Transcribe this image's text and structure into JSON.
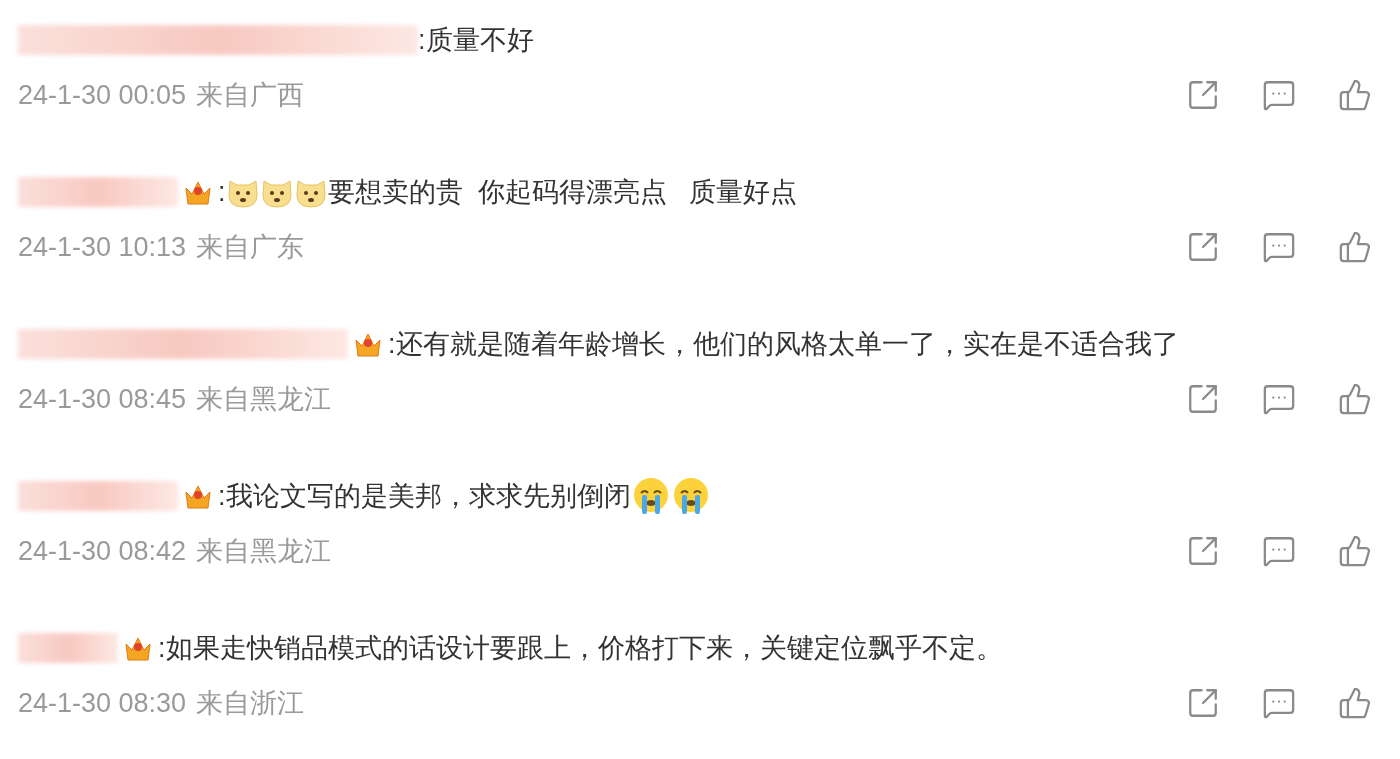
{
  "comments": [
    {
      "badge": false,
      "content": [
        {
          "kind": "text",
          "text": ":质量不好"
        }
      ],
      "time": "24-1-30 00:05",
      "origin": "来自广西"
    },
    {
      "badge": true,
      "content": [
        {
          "kind": "text",
          "text": ":"
        },
        {
          "kind": "doge"
        },
        {
          "kind": "doge"
        },
        {
          "kind": "doge"
        },
        {
          "kind": "text",
          "text": "要想卖的贵  你起码得漂亮点   质量好点"
        }
      ],
      "time": "24-1-30 10:13",
      "origin": "来自广东"
    },
    {
      "badge": true,
      "content": [
        {
          "kind": "text",
          "text": ":还有就是随着年龄增长，他们的风格太单一了，实在是不适合我了"
        }
      ],
      "time": "24-1-30 08:45",
      "origin": "来自黑龙江"
    },
    {
      "badge": true,
      "content": [
        {
          "kind": "text",
          "text": ":我论文写的是美邦，求求先别倒闭"
        },
        {
          "kind": "crying"
        },
        {
          "kind": "crying"
        }
      ],
      "time": "24-1-30 08:42",
      "origin": "来自黑龙江"
    },
    {
      "badge": true,
      "content": [
        {
          "kind": "text",
          "text": ":如果走快销品模式的话设计要跟上，价格打下来，关键定位飘乎不定。"
        }
      ],
      "time": "24-1-30 08:30",
      "origin": "来自浙江"
    }
  ]
}
